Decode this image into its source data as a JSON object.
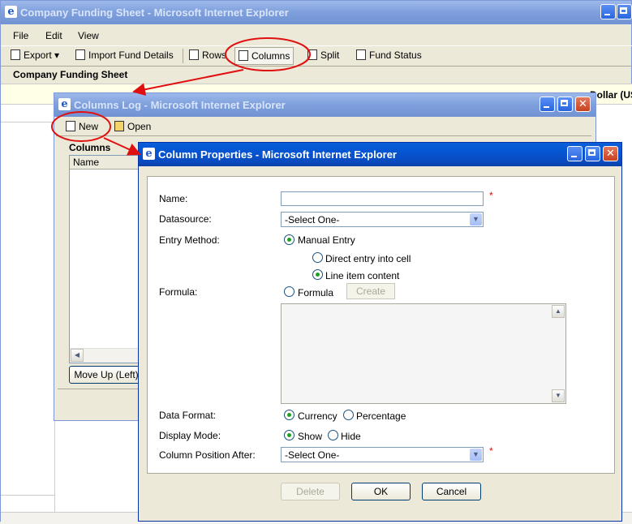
{
  "main_window": {
    "title": "Company Funding Sheet - Microsoft Internet Explorer",
    "menu": [
      "File",
      "Edit",
      "View"
    ],
    "toolbar": {
      "export": "Export",
      "import_fund_details": "Import Fund Details",
      "rows": "Rows",
      "columns": "Columns",
      "split": "Split",
      "fund_status": "Fund Status"
    },
    "page_title": "Company Funding Sheet",
    "currency_text": "Dollar (US"
  },
  "columns_log": {
    "title": "Columns Log - Microsoft Internet Explorer",
    "toolbar": {
      "new": "New",
      "open": "Open"
    },
    "section_label": "Columns",
    "list_header": "Name",
    "move_up_button": "Move Up (Left)"
  },
  "column_properties": {
    "title": "Column Properties - Microsoft Internet Explorer",
    "name_label": "Name:",
    "name_value": "",
    "datasource_label": "Datasource:",
    "datasource_value": "-Select One-",
    "entry_method_label": "Entry Method:",
    "manual_entry": "Manual Entry",
    "direct_entry": "Direct entry into cell",
    "line_item": "Line item content",
    "formula_label": "Formula:",
    "formula_option": "Formula",
    "create_button": "Create",
    "data_format_label": "Data Format:",
    "currency_option": "Currency",
    "percentage_option": "Percentage",
    "display_mode_label": "Display Mode:",
    "show_option": "Show",
    "hide_option": "Hide",
    "position_after_label": "Column Position After:",
    "position_after_value": "-Select One-",
    "required_mark": "*",
    "buttons": {
      "delete": "Delete",
      "ok": "OK",
      "cancel": "Cancel"
    }
  },
  "colors": {
    "titlebar": "#0554d2",
    "annotation": "#e01010",
    "required": "#ee0000"
  }
}
